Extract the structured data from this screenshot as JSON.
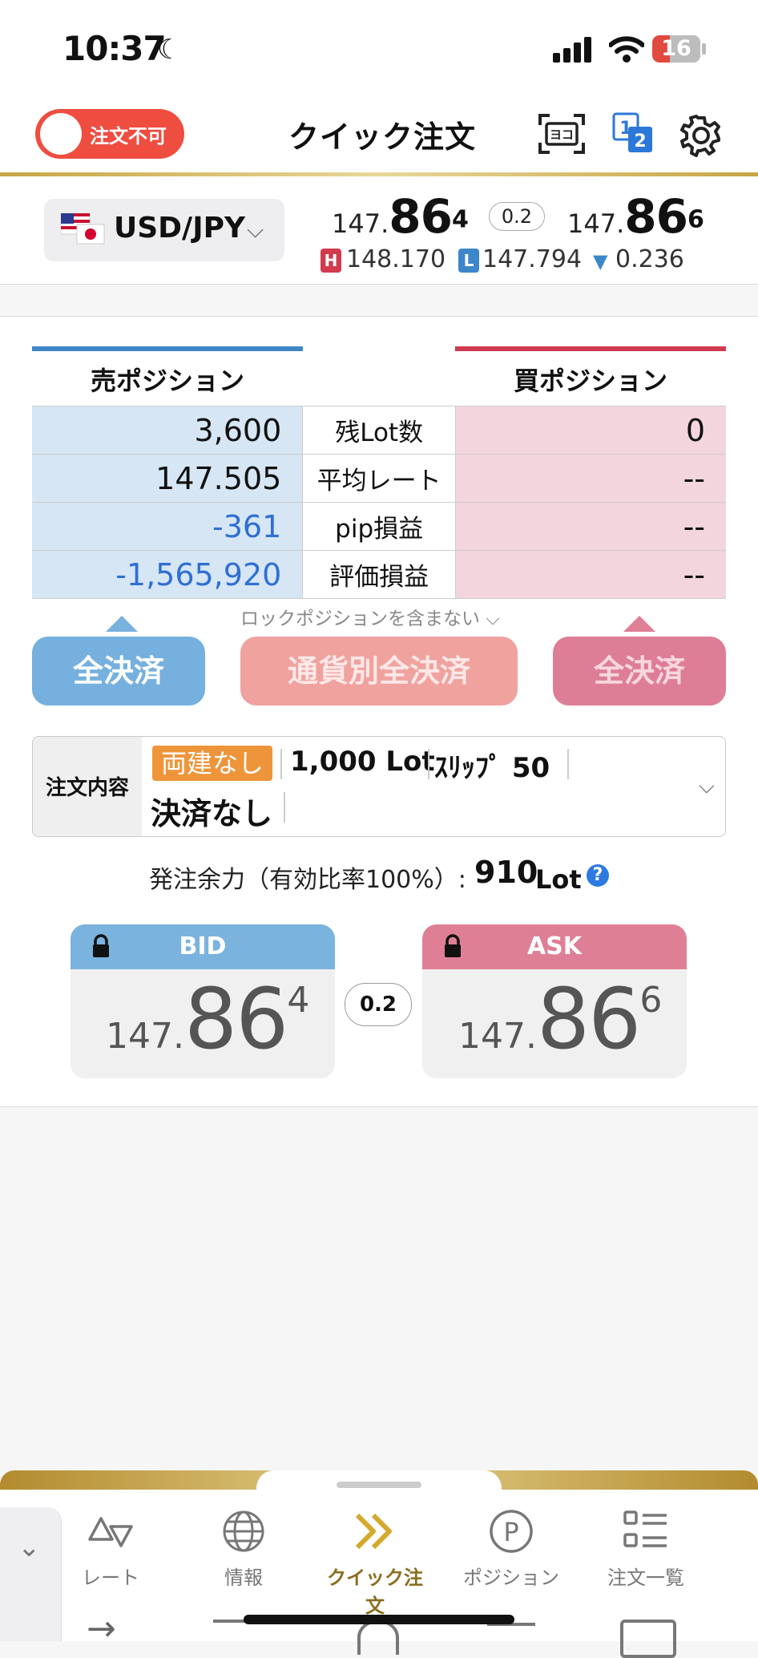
{
  "status": {
    "time": "10:37",
    "battery": "16"
  },
  "header": {
    "toggle_label": "注文不可",
    "title": "クイック注文",
    "scan_text": "ヨコ"
  },
  "rate": {
    "pair": "USD/JPY",
    "bid": {
      "small": "147.",
      "big": "86",
      "pip": "4"
    },
    "ask": {
      "small": "147.",
      "big": "86",
      "pip": "6"
    },
    "spread": "0.2",
    "high_badge": "H",
    "high": "148.170",
    "low_badge": "L",
    "low": "147.794",
    "change": "0.236"
  },
  "positions": {
    "sell_title": "売ポジション",
    "buy_title": "買ポジション",
    "rows": [
      {
        "label": "残Lot数",
        "sell": "3,600",
        "buy": "0"
      },
      {
        "label": "平均レート",
        "sell": "147.505",
        "buy": "--"
      },
      {
        "label": "pip損益",
        "sell": "-361",
        "buy": "--"
      },
      {
        "label": "評価損益",
        "sell": "-1,565,920",
        "buy": "--"
      }
    ],
    "lock_note": "ロックポジションを含まない",
    "sell_all": "全決済",
    "currency_all": "通貨別全決済",
    "buy_all": "全決済"
  },
  "order": {
    "label": "注文内容",
    "hedge": "両建なし",
    "lot": "1,000 Lot",
    "slip": "ｽﾘｯﾌﾟ 50",
    "settle": "決済なし"
  },
  "margin": {
    "text": "発注余力（有効比率100%）:",
    "value": "910",
    "unit": "Lot",
    "help": "?"
  },
  "cards": {
    "bid_label": "BID",
    "ask_label": "ASK",
    "bid": {
      "small": "147.",
      "big": "86",
      "pip": "4"
    },
    "ask": {
      "small": "147.",
      "big": "86",
      "pip": "6"
    },
    "spread": "0.2"
  },
  "nav": {
    "items": [
      {
        "label": "レート",
        "icon": "rate-triangles-icon"
      },
      {
        "label": "情報",
        "icon": "globe-icon"
      },
      {
        "label": "クイック注文",
        "icon": "double-chevron-icon"
      },
      {
        "label": "ポジション",
        "icon": "p-circle-icon"
      },
      {
        "label": "注文一覧",
        "icon": "list-icon"
      }
    ]
  },
  "colors": {
    "sell": "#3e86c8",
    "buy": "#cf3b50",
    "gold": "#c8a544",
    "toggle": "#ee4d40"
  }
}
